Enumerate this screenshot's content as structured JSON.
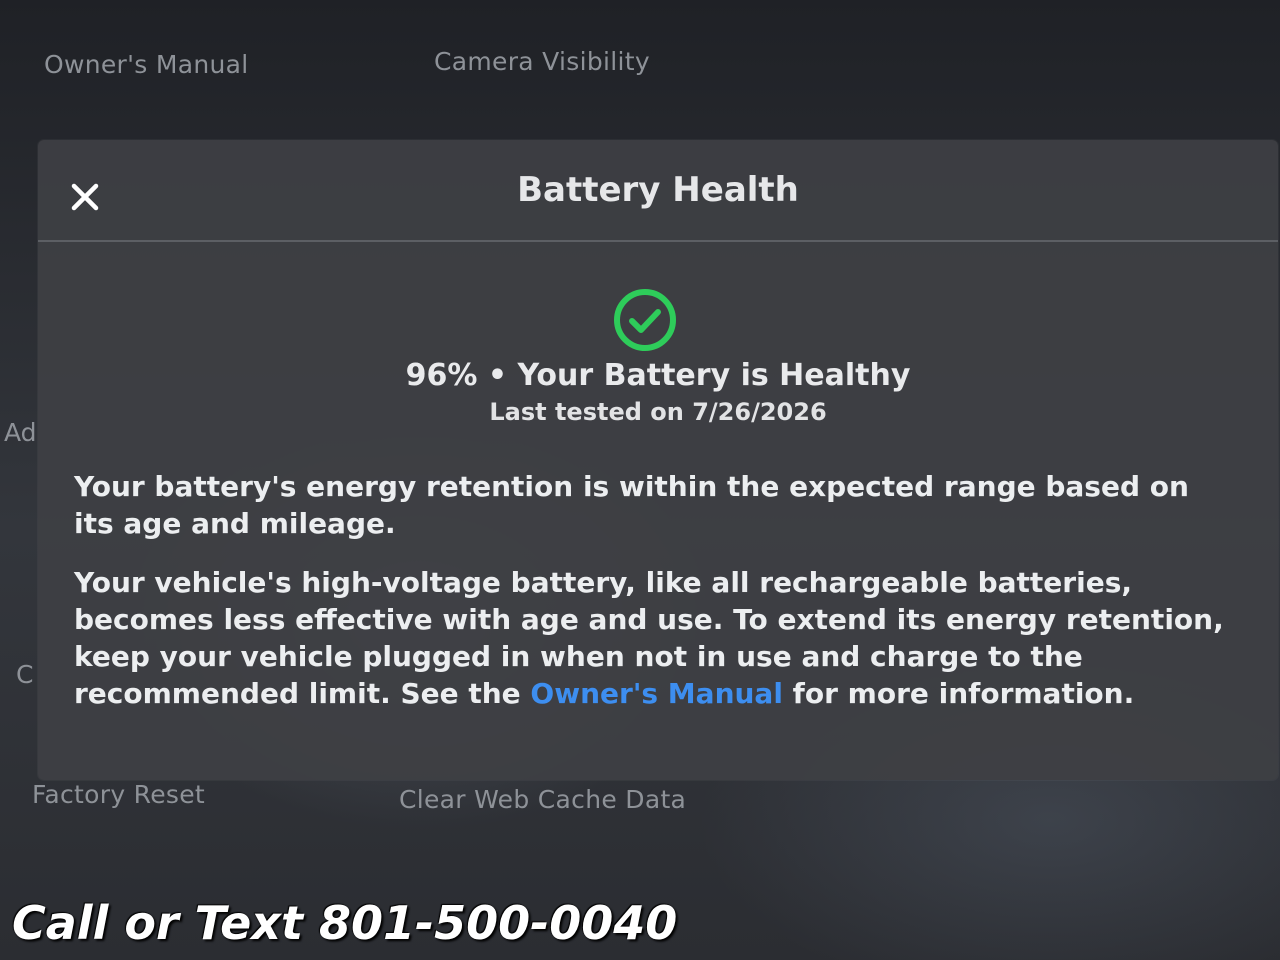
{
  "background": {
    "items": [
      {
        "label": "Owner's Manual"
      },
      {
        "label": "Camera Visibility"
      },
      {
        "label": "Factory Reset"
      },
      {
        "label": "Clear Web Cache Data"
      }
    ],
    "edge_fragments": [
      "Ad",
      "C"
    ]
  },
  "modal": {
    "title": "Battery Health",
    "status_icon": "check-circle-icon",
    "status_color": "#2ecc5a",
    "status_text": "96% • Your Battery is Healthy",
    "battery_percent": 96,
    "last_tested": "Last tested on 7/26/2026",
    "paragraph1": "Your battery's energy retention is within the expected range based on its age and mileage.",
    "paragraph2_before": "Your vehicle's high-voltage battery, like all rechargeable batteries, becomes less effective with age and use. To extend its energy retention, keep your vehicle plugged in when not in use and charge to the recommended limit. See the ",
    "paragraph2_link": "Owner's Manual",
    "paragraph2_after": " for more information.",
    "link_color": "#3d8ef0"
  },
  "watermark": "Call or Text 801-500-0040"
}
